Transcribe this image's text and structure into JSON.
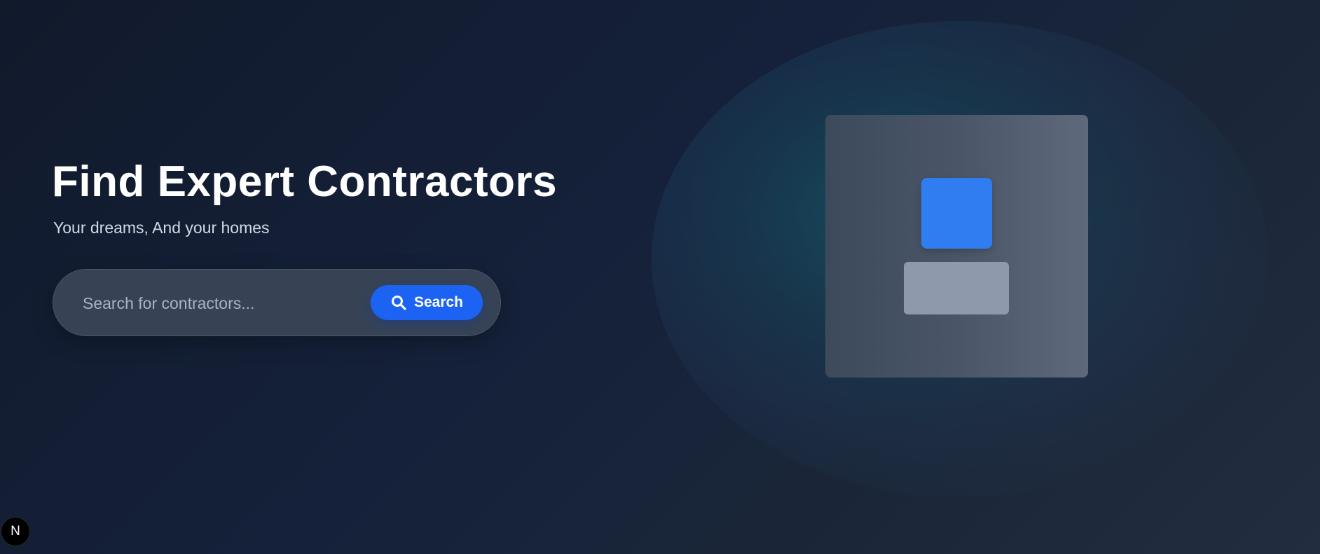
{
  "hero": {
    "title": "Find Expert Contractors",
    "subtitle": "Your dreams, And your homes"
  },
  "search": {
    "placeholder": "Search for contractors...",
    "value": "",
    "button_label": "Search",
    "button_icon": "search-icon"
  },
  "illustration": {
    "description_icon": "placeholder-graphic"
  },
  "badge": {
    "label": "N",
    "icon": "nextjs-logo-icon"
  },
  "colors": {
    "background": "#131c2e",
    "accent": "#1d63f3",
    "illustration_square": "#2f7df0",
    "illustration_rect": "#8e9aab",
    "glow": "#16707d"
  }
}
